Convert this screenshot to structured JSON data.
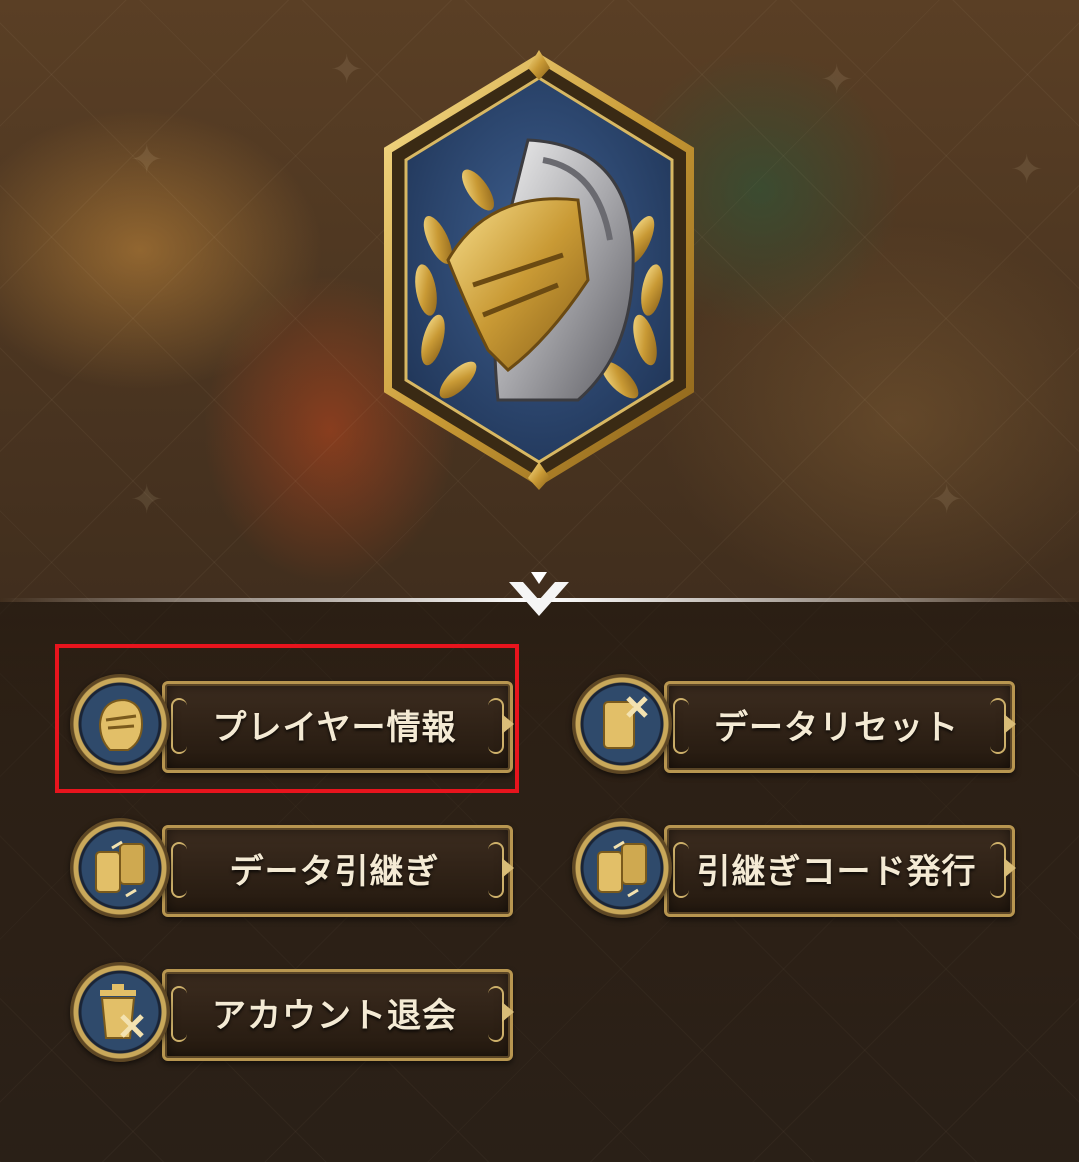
{
  "menu": {
    "player_info": "プレイヤー情報",
    "data_reset": "データリセット",
    "data_transfer": "データ引継ぎ",
    "transfer_code_issue": "引継ぎコード発行",
    "account_withdrawal": "アカウント退会"
  },
  "colors": {
    "gold_border": "#b89650",
    "plate_dark": "#24190f",
    "label_text": "#f4ead4",
    "medal_blue": "#2f4a6b",
    "highlight_red": "#e8141d"
  },
  "icons": {
    "emblem": "knight-helmet-laurel-emblem",
    "player_info": "knight-helmet-icon",
    "data_reset": "phone-cross-icon",
    "data_transfer": "phone-transfer-icon",
    "transfer_code_issue": "phone-transfer-icon",
    "account_withdrawal": "trash-cross-icon"
  }
}
